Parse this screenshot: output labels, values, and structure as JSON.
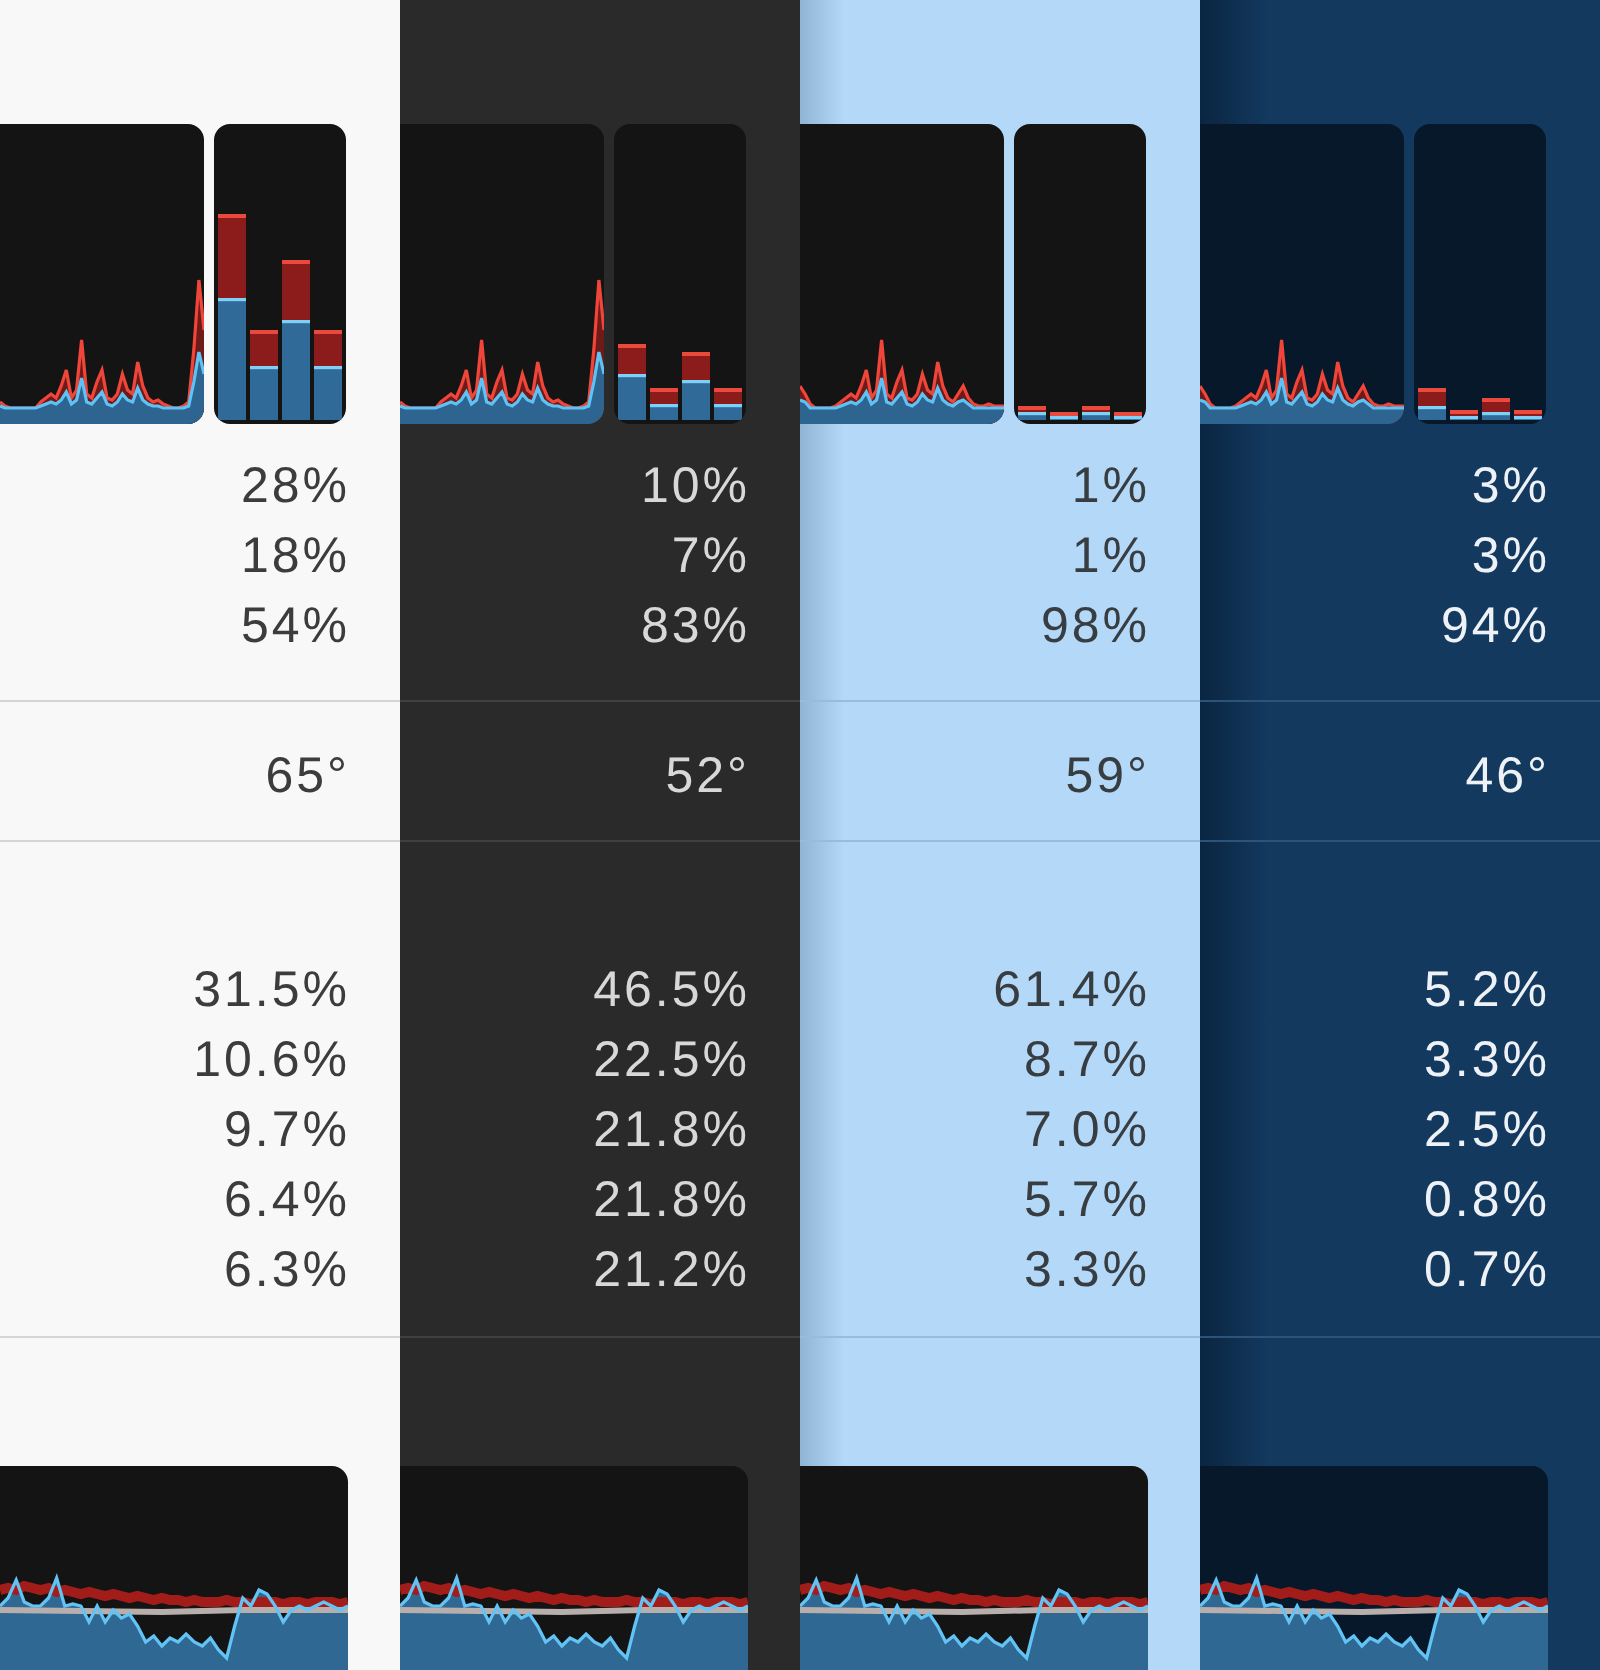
{
  "panels": [
    {
      "kind": "light",
      "section_1": [
        "28%",
        "18%",
        "54%"
      ],
      "section_2": [
        "65°"
      ],
      "section_3": [
        "31.5%",
        "10.6%",
        "9.7%",
        "6.4%",
        "6.3%"
      ]
    },
    {
      "kind": "dark",
      "section_1": [
        "10%",
        "7%",
        "83%"
      ],
      "section_2": [
        "52°"
      ],
      "section_3": [
        "46.5%",
        "22.5%",
        "21.8%",
        "21.8%",
        "21.2%"
      ]
    },
    {
      "kind": "sky",
      "section_1": [
        "1%",
        "1%",
        "98%"
      ],
      "section_2": [
        "59°"
      ],
      "section_3": [
        "61.4%",
        "8.7%",
        "7.0%",
        "5.7%",
        "3.3%"
      ]
    },
    {
      "kind": "navy",
      "section_1": [
        "3%",
        "3%",
        "94%"
      ],
      "section_2": [
        "46°"
      ],
      "section_3": [
        "5.2%",
        "3.3%",
        "2.5%",
        "0.8%",
        "0.7%"
      ]
    }
  ]
}
